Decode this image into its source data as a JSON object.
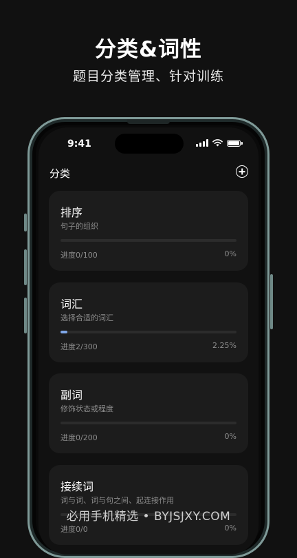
{
  "promo": {
    "title": "分类&词性",
    "subtitle": "题目分类管理、针对训练"
  },
  "status_bar": {
    "time": "9:41",
    "icons": [
      "signal-icon",
      "wifi-icon",
      "battery-icon"
    ]
  },
  "header": {
    "title": "分类",
    "add_icon": "plus-circle-icon"
  },
  "colors": {
    "background": "#111111",
    "card": "#1c1c1c",
    "progress_track": "#2c2c2c",
    "progress_fill": "#7fa7e8",
    "frame": "#7f9a98"
  },
  "categories": [
    {
      "title": "排序",
      "desc": "句子的组织",
      "progress_label": "进度0/100",
      "percent": "0%",
      "progress_fraction": 0
    },
    {
      "title": "词汇",
      "desc": "选择合适的词汇",
      "progress_label": "进度2/300",
      "percent": "2.25%",
      "progress_fraction": 0.0225
    },
    {
      "title": "副词",
      "desc": "修饰状态或程度",
      "progress_label": "进度0/200",
      "percent": "0%",
      "progress_fraction": 0
    },
    {
      "title": "接续词",
      "desc": "词与词、词与句之间、起连接作用",
      "progress_label": "进度0/0",
      "percent": "0%",
      "progress_fraction": 0
    }
  ],
  "watermark": "必用手机精选 • BYJSJXY.COM"
}
